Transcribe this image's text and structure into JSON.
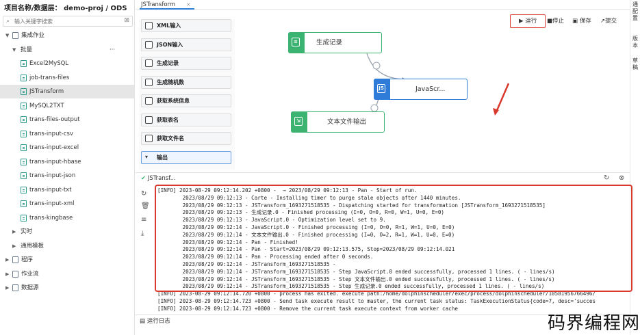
{
  "project_title": "项目名称/数据层： demo-proj / ODS",
  "search": {
    "placeholder": "输入关键字搜索"
  },
  "tree": [
    {
      "label": "集成作业",
      "level": 0,
      "expanded": true
    },
    {
      "label": "批量",
      "level": 1,
      "expanded": true
    },
    {
      "label": "Excel2MySQL",
      "level": 2
    },
    {
      "label": "job-trans-files",
      "level": 2
    },
    {
      "label": "JSTransform",
      "level": 2,
      "selected": true
    },
    {
      "label": "MySQL2TXT",
      "level": 2
    },
    {
      "label": "trans-files-output",
      "level": 2
    },
    {
      "label": "trans-input-csv",
      "level": 2
    },
    {
      "label": "trans-input-excel",
      "level": 2
    },
    {
      "label": "trans-input-hbase",
      "level": 2
    },
    {
      "label": "trans-input-json",
      "level": 2
    },
    {
      "label": "trans-input-txt",
      "level": 2
    },
    {
      "label": "trans-input-xml",
      "level": 2
    },
    {
      "label": "trans-kingbase",
      "level": 2
    },
    {
      "label": "实时",
      "level": 1
    },
    {
      "label": "通用模板",
      "level": 1
    },
    {
      "label": "程序",
      "level": 0
    },
    {
      "label": "作业流",
      "level": 0
    },
    {
      "label": "数据源",
      "level": 0
    }
  ],
  "tree_more": "···",
  "tab": {
    "label": "JSTransform",
    "close": "×"
  },
  "right_strip": [
    "通配置",
    "版本",
    "草稿"
  ],
  "toolbar": {
    "run": "运行",
    "stop": "停止",
    "save": "保存",
    "submit": "提交"
  },
  "components": [
    "XML输入",
    "JSON输入",
    "生成记录",
    "生成随机数",
    "获取系统信息",
    "获取表名",
    "获取文件名",
    "输出"
  ],
  "nodes": [
    {
      "label": "生成记录",
      "type": "generate"
    },
    {
      "label": "JavaScr...",
      "type": "js"
    },
    {
      "label": "文本文件输出",
      "type": "text"
    }
  ],
  "log_tab": "JSTransf...",
  "log_lines": [
    "[INFO] 2023-08-29 09:12:14.202 +0800 -  → 2023/08/29 09:12:13 - Pan - Start of run.",
    "        2023/08/29 09:12:13 - Carte - Installing timer to purge stale objects after 1440 minutes.",
    "        2023/08/29 09:12:13 - JSTransform_1693271518535 - Dispatching started for transformation [JSTransform_1693271518535]",
    "        2023/08/29 09:12:13 - 生成记录.0 - Finished processing (I=0, O=0, R=0, W=1, U=0, E=0)",
    "        2023/08/29 09:12:13 - JavaScript.0 - Optimization level set to 9.",
    "        2023/08/29 09:12:14 - JavaScript.0 - Finished processing (I=0, O=0, R=1, W=1, U=0, E=0)",
    "        2023/08/29 09:12:14 - 文本文件输出.0 - Finished processing (I=0, O=2, R=1, W=1, U=0, E=0)",
    "        2023/08/29 09:12:14 - Pan - Finished!",
    "        2023/08/29 09:12:14 - Pan - Start=2023/08/29 09:12:13.575, Stop=2023/08/29 09:12:14.021",
    "        2023/08/29 09:12:14 - Pan - Processing ended after 0 seconds.",
    "        2023/08/29 09:12:14 - JSTransform_1693271518535 -",
    "        2023/08/29 09:12:14 - JSTransform_1693271518535 - Step JavaScript.0 ended successfully, processed 1 lines. ( - lines/s)",
    "        2023/08/29 09:12:14 - JSTransform_1693271518535 - Step 文本文件输出.0 ended successfully, processed 1 lines. ( - lines/s)",
    "        2023/08/29 09:12:14 - JSTransform_1693271518535 - Step 生成记录.0 ended successfully, processed 1 lines. ( - lines/s)",
    "[INFO] 2023-08-29 09:12:14.720 +0800 - process has exited. execute path:/home/dolphinscheduler/exec/process/dolphinscheduler/10581956766496/",
    "[INFO] 2023-08-29 09:12:14.723 +0800 - Send task execute result to master, the current task status: TaskExecutionStatus{code=7, desc='succes",
    "[INFO] 2023-08-29 09:12:14.723 +0800 - Remove the current task execute context from worker cache"
  ],
  "log_footer": "运行日志",
  "watermark": "码界编程网",
  "colors": {
    "accent": "#2f7bd8",
    "highlight": "#d9392c",
    "node_green": "#3cb371"
  }
}
